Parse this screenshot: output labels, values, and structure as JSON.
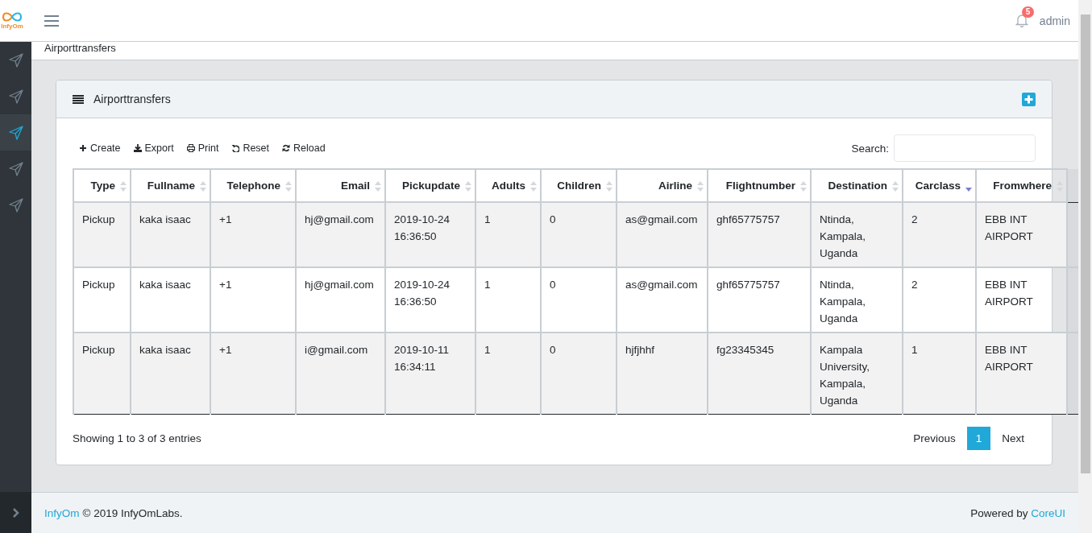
{
  "header": {
    "logo_text": "InfyOm",
    "notifications": "5",
    "user": "admin"
  },
  "sidebar": {
    "items": [
      {
        "selected": false
      },
      {
        "selected": false
      },
      {
        "selected": true
      },
      {
        "selected": false
      },
      {
        "selected": false
      }
    ]
  },
  "breadcrumb": "Airporttransfers",
  "card": {
    "title": "Airporttransfers",
    "toolbar": [
      {
        "kind": "create",
        "label": "Create"
      },
      {
        "kind": "export",
        "label": "Export"
      },
      {
        "kind": "print",
        "label": "Print"
      },
      {
        "kind": "reset",
        "label": "Reset"
      },
      {
        "kind": "reload",
        "label": "Reload"
      }
    ],
    "search": {
      "label": "Search:"
    },
    "table": {
      "columns": [
        {
          "label": "Type",
          "sorted": false
        },
        {
          "label": "Fullname",
          "sorted": false
        },
        {
          "label": "Telephone",
          "sorted": false
        },
        {
          "label": "Email",
          "sorted": false
        },
        {
          "label": "Pickupdate",
          "sorted": false
        },
        {
          "label": "Adults",
          "sorted": false
        },
        {
          "label": "Children",
          "sorted": false
        },
        {
          "label": "Airline",
          "sorted": false
        },
        {
          "label": "Flightnumber",
          "sorted": false
        },
        {
          "label": "Destination",
          "sorted": false
        },
        {
          "label": "Carclass",
          "sorted": true
        },
        {
          "label": "Fromwhere",
          "sorted": false
        }
      ],
      "rows": [
        [
          "Pickup",
          "kaka isaac",
          "+1",
          "hj@gmail.com",
          "2019-10-24 16:36:50",
          "1",
          "0",
          "as@gmail.com",
          "ghf65775757",
          "Ntinda, Kampala, Uganda",
          "2",
          "EBB INT AIRPORT"
        ],
        [
          "Pickup",
          "kaka isaac",
          "+1",
          "hj@gmail.com",
          "2019-10-24 16:36:50",
          "1",
          "0",
          "as@gmail.com",
          "ghf65775757",
          "Ntinda, Kampala, Uganda",
          "2",
          "EBB INT AIRPORT"
        ],
        [
          "Pickup",
          "kaka isaac",
          "+1",
          "i@gmail.com",
          "2019-10-11 16:34:11",
          "1",
          "0",
          "hjfjhhf",
          "fg23345345",
          "Kampala University, Kampala, Uganda",
          "1",
          "EBB INT AIRPORT"
        ]
      ]
    },
    "info": "Showing 1 to 3 of 3 entries",
    "pagination": [
      {
        "label": "Previous",
        "selected": false
      },
      {
        "label": "1",
        "selected": true
      },
      {
        "label": "Next",
        "selected": false
      }
    ]
  },
  "footer": {
    "brand": "InfyOm",
    "text": "© 2019 InfyOmLabs.",
    "powered": "Powered by",
    "link": "CoreUI"
  }
}
